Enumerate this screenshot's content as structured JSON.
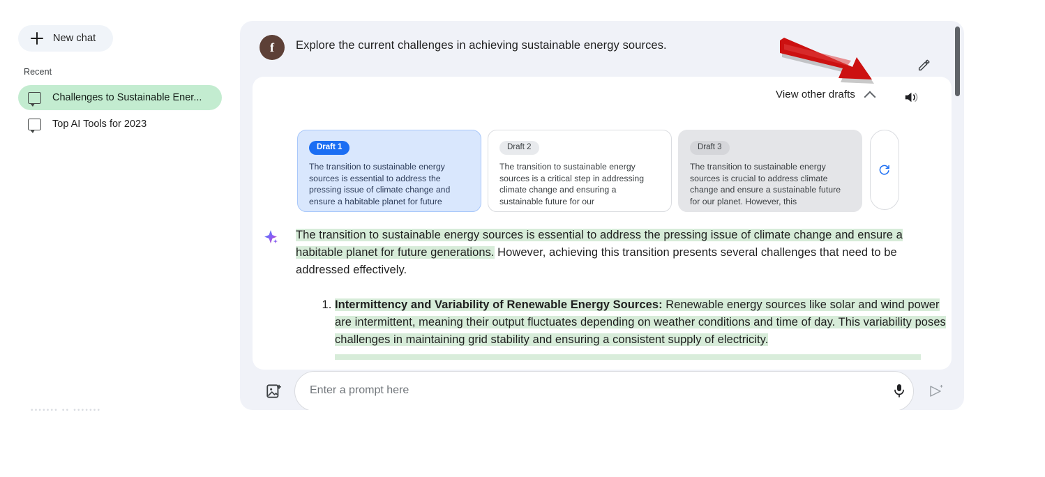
{
  "sidebar": {
    "new_chat_label": "New chat",
    "recent_label": "Recent",
    "items": [
      {
        "label": "Challenges to Sustainable Ener...",
        "icon": "chat-bubble-icon",
        "selected": true
      },
      {
        "label": "Top AI Tools for 2023",
        "icon": "chat-bubble-icon",
        "selected": false
      }
    ],
    "footer_note": "••••••• ••  •••••••"
  },
  "conversation": {
    "avatar_letter": "f",
    "prompt_text": "Explore the current challenges in achieving sustainable energy sources.",
    "edit_icon": "pencil-icon",
    "speaker_icon": "volume-icon"
  },
  "drafts": {
    "view_label": "View other drafts",
    "chevron_icon": "chevron-up-icon",
    "refresh_icon": "refresh-icon",
    "cards": [
      {
        "badge": "Draft 1",
        "body": "The transition to sustainable energy sources is essential to address the pressing issue of climate change and ensure a habitable planet for future",
        "state": "selected"
      },
      {
        "badge": "Draft 2",
        "body": "The transition to sustainable energy sources is a critical step in addressing climate change and ensuring a sustainable future for our",
        "state": "unselected"
      },
      {
        "badge": "Draft 3",
        "body": "The transition to sustainable energy sources is crucial to address climate change and ensure a sustainable future for our planet. However, this",
        "state": "gray"
      }
    ]
  },
  "answer": {
    "sparkle_icon": "sparkle-icon",
    "highlighted_intro": "The transition to sustainable energy sources is essential to address the pressing issue of climate change and ensure a habitable planet for future generations.",
    "rest_intro": " However, achieving this transition presents several challenges that need to be addressed effectively.",
    "list": [
      {
        "number": "1.",
        "title": "Intermittency and Variability of Renewable Energy Sources:",
        "body": " Renewable energy sources like solar and wind power are intermittent, meaning their output fluctuates depending on weather conditions and time of day. This variability poses challenges in maintaining grid stability and ensuring a consistent supply of electricity."
      }
    ]
  },
  "composer": {
    "image_icon": "image-upload-icon",
    "placeholder": "Enter a prompt here",
    "value": "",
    "mic_icon": "microphone-icon",
    "send_icon": "send-icon"
  },
  "annotation": {
    "arrow_icon": "red-arrow-annotation",
    "arrow_color": "#cc1111"
  },
  "colors": {
    "page_background": "#ffffff",
    "panel_background": "#f0f2f8",
    "card_background": "#ffffff",
    "selected_chat": "#c3ecd0",
    "highlight_green": "#d7ecd9",
    "draft_selected_blue": "#d9e7fd",
    "badge_blue": "#1b6ef3",
    "avatar_brown": "#5d4037",
    "accent_red": "#cc1111"
  }
}
